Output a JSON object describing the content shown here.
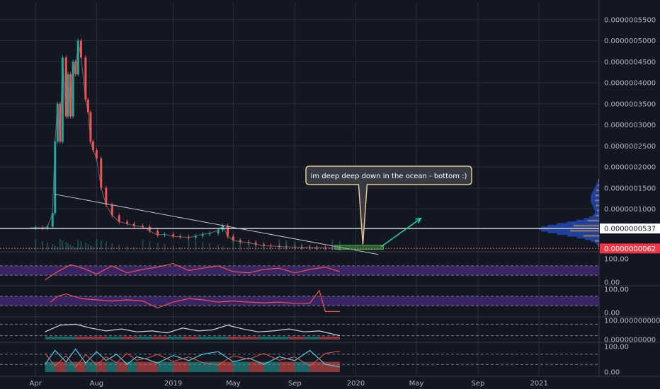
{
  "chart_data": {
    "type": "line",
    "title": "",
    "main_panel": {
      "y_ticks": [
        "0.0000005500",
        "0.0000005000",
        "0.0000004500",
        "0.0000004000",
        "0.0000003500",
        "0.0000003000",
        "0.0000002500",
        "0.0000002000",
        "0.0000001500",
        "0.0000001000"
      ],
      "y_tick_values": [
        5.5e-07,
        5e-07,
        4.5e-07,
        4e-07,
        3.5e-07,
        3e-07,
        2.5e-07,
        2e-07,
        1.5e-07,
        1e-07
      ],
      "ylim": [
        0,
        5.9e-07
      ],
      "resistance_label": "0.0000000537",
      "resistance_value": 5.37e-08,
      "current_label": "0.0000000062",
      "current_value": 6.2e-09,
      "annotation": "im deep deep down in the ocean - bottom :)",
      "x_ticks": [
        "Apr",
        "Aug",
        "2019",
        "May",
        "Sep",
        "2020",
        "May",
        "Sep",
        "2021"
      ],
      "x_tick_dates": [
        "2018-04-01",
        "2018-08-01",
        "2019-01-01",
        "2019-05-01",
        "2019-09-01",
        "2020-01-01",
        "2020-05-01",
        "2020-09-01",
        "2021-01-01"
      ],
      "xlim": [
        "2018-01-20",
        "2021-05-01"
      ],
      "data_end": "2019-11-30",
      "price_series": {
        "dates": [
          "2018-03-20",
          "2018-04-01",
          "2018-04-15",
          "2018-04-25",
          "2018-05-05",
          "2018-05-10",
          "2018-05-15",
          "2018-05-20",
          "2018-05-25",
          "2018-06-01",
          "2018-06-05",
          "2018-06-10",
          "2018-06-15",
          "2018-06-20",
          "2018-06-25",
          "2018-07-01",
          "2018-07-10",
          "2018-07-15",
          "2018-07-20",
          "2018-07-25",
          "2018-08-01",
          "2018-08-10",
          "2018-08-20",
          "2018-09-01",
          "2018-09-15",
          "2018-10-01",
          "2018-10-15",
          "2018-11-01",
          "2018-11-15",
          "2018-12-01",
          "2018-12-15",
          "2019-01-01",
          "2019-01-15",
          "2019-02-01",
          "2019-02-15",
          "2019-03-01",
          "2019-03-15",
          "2019-04-01",
          "2019-04-10",
          "2019-04-20",
          "2019-05-01",
          "2019-05-15",
          "2019-06-01",
          "2019-06-15",
          "2019-07-01",
          "2019-07-15",
          "2019-08-01",
          "2019-08-15",
          "2019-09-01",
          "2019-09-15",
          "2019-10-01",
          "2019-10-15",
          "2019-11-01",
          "2019-11-15",
          "2019-11-30"
        ],
        "values": [
          5.5e-08,
          5.6e-08,
          5.5e-08,
          5.8e-08,
          9e-08,
          2.6e-07,
          3.5e-07,
          2.6e-07,
          4.6e-07,
          3.2e-07,
          4.2e-07,
          3.2e-07,
          4.5e-07,
          4.2e-07,
          5e-07,
          4.6e-07,
          3.6e-07,
          3.3e-07,
          2.6e-07,
          2.4e-07,
          2.2e-07,
          1.5e-07,
          1.1e-07,
          8.5e-08,
          7e-08,
          6.5e-08,
          6e-08,
          5.8e-08,
          4.8e-08,
          3.8e-08,
          4e-08,
          3.5e-08,
          3.4e-08,
          3.2e-08,
          3.6e-08,
          4e-08,
          4.2e-08,
          5e-08,
          6e-08,
          3.5e-08,
          2.6e-08,
          2.2e-08,
          2e-08,
          1.6e-08,
          1.3e-08,
          1.2e-08,
          1.1e-08,
          1e-08,
          9.5e-09,
          9e-09,
          8.5e-09,
          8e-09,
          7.5e-09,
          7e-09,
          6.2e-09
        ]
      }
    },
    "indicators": [
      {
        "name": "",
        "top_label": "100.00",
        "bottom_label": "0.00",
        "dates": [
          "2018-04-20",
          "2018-05-15",
          "2018-06-10",
          "2018-07-05",
          "2018-08-01",
          "2018-09-01",
          "2018-10-01",
          "2018-11-01",
          "2018-12-01",
          "2019-01-01",
          "2019-02-01",
          "2019-03-01",
          "2019-04-01",
          "2019-05-01",
          "2019-06-01",
          "2019-07-01",
          "2019-08-01",
          "2019-09-01",
          "2019-10-01",
          "2019-11-01",
          "2019-11-30"
        ],
        "values": [
          10,
          45,
          75,
          60,
          35,
          70,
          40,
          55,
          65,
          80,
          50,
          60,
          70,
          45,
          40,
          55,
          60,
          40,
          55,
          65,
          45
        ]
      },
      {
        "name": "",
        "top_label": "100.00",
        "bottom_label": "0.00",
        "dates": [
          "2018-05-01",
          "2018-05-15",
          "2018-06-01",
          "2018-07-01",
          "2018-08-01",
          "2018-09-01",
          "2018-10-01",
          "2018-11-01",
          "2018-12-01",
          "2019-01-01",
          "2019-02-01",
          "2019-03-01",
          "2019-04-01",
          "2019-05-01",
          "2019-06-01",
          "2019-07-01",
          "2019-08-01",
          "2019-09-01",
          "2019-10-01",
          "2019-10-20",
          "2019-11-01",
          "2019-11-30"
        ],
        "values": [
          45,
          70,
          80,
          60,
          55,
          50,
          55,
          50,
          20,
          45,
          60,
          55,
          45,
          50,
          45,
          42,
          45,
          40,
          40,
          95,
          5,
          5
        ]
      },
      {
        "name": "",
        "top_label": "100.0000000000",
        "bottom_label": "0.0000000000",
        "dates": [
          "2018-04-20",
          "2018-05-20",
          "2018-06-20",
          "2018-07-20",
          "2018-08-20",
          "2018-09-20",
          "2018-10-20",
          "2018-11-20",
          "2018-12-20",
          "2019-01-20",
          "2019-02-20",
          "2019-03-20",
          "2019-04-20",
          "2019-05-20",
          "2019-06-20",
          "2019-07-20",
          "2019-08-20",
          "2019-09-20",
          "2019-10-20",
          "2019-11-30"
        ],
        "values": [
          40,
          75,
          80,
          60,
          45,
          55,
          40,
          45,
          35,
          60,
          45,
          50,
          75,
          55,
          40,
          45,
          55,
          40,
          45,
          20
        ]
      },
      {
        "name": "",
        "top_label": "100.00",
        "bottom_label": "0.00",
        "dates": [
          "2018-04-20",
          "2018-05-10",
          "2018-06-01",
          "2018-06-20",
          "2018-07-10",
          "2018-08-01",
          "2018-08-20",
          "2018-09-10",
          "2018-10-01",
          "2018-10-20",
          "2018-11-10",
          "2018-12-01",
          "2019-01-01",
          "2019-02-01",
          "2019-03-01",
          "2019-04-01",
          "2019-05-01",
          "2019-06-01",
          "2019-07-01",
          "2019-08-01",
          "2019-09-01",
          "2019-10-01",
          "2019-11-01",
          "2019-11-30"
        ],
        "values": [
          30,
          85,
          40,
          90,
          35,
          80,
          45,
          70,
          30,
          60,
          50,
          35,
          65,
          45,
          70,
          80,
          40,
          55,
          30,
          60,
          45,
          85,
          30,
          20
        ]
      }
    ],
    "grid": true,
    "colors": {
      "background": "#131722",
      "grid": "#2a2e39",
      "up": "#26a69a",
      "down": "#ef5350",
      "white_line": "#d1d4dc",
      "rsi_band": "#4a2a7a",
      "callout_bg": "#363a45",
      "callout_border": "#e6c990",
      "target_box": "#4caf50",
      "arrow": "#26d9a0",
      "current_badge": "#f23645"
    }
  }
}
